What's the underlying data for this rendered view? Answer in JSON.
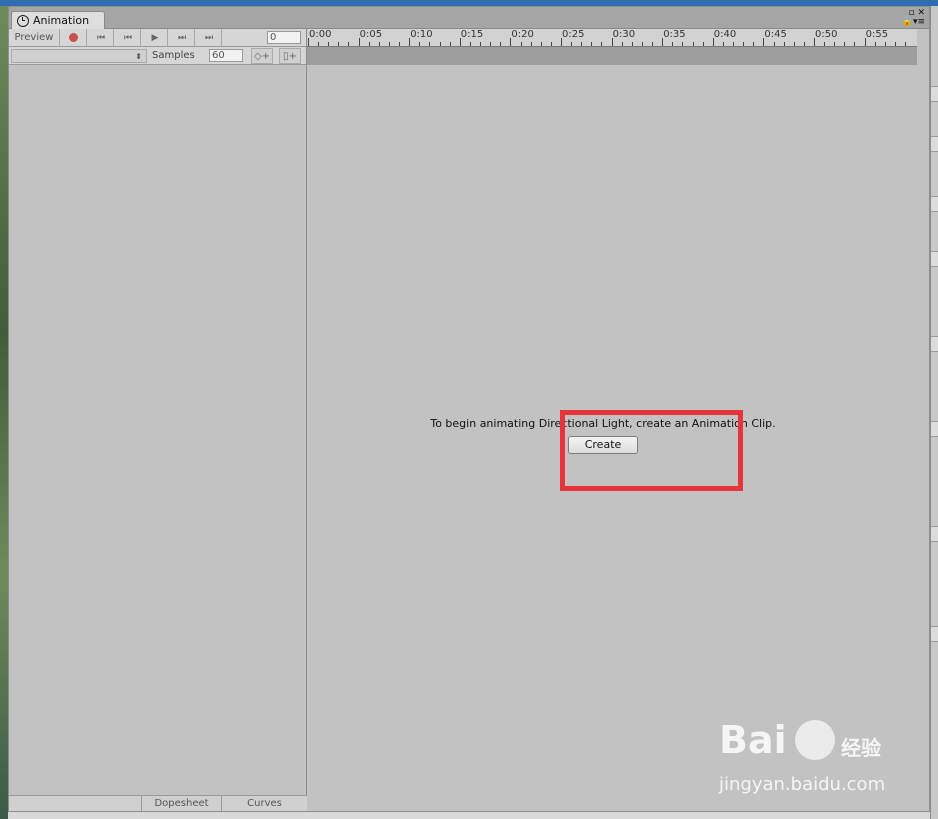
{
  "window": {
    "tab_title": "Animation",
    "corner_icons": "▫ ✕\n🔒▾≡"
  },
  "toolbar": {
    "preview_label": "Preview",
    "first_key_glyph": "⏮",
    "prev_key_glyph": "⏮",
    "play_glyph": "▶",
    "next_key_glyph": "⏭",
    "last_key_glyph": "⏭",
    "frame_value": "0",
    "clip_dropdown_arrow": "⬍",
    "samples_label": "Samples",
    "samples_value": "60",
    "add_keyframe_glyph": "◇+",
    "add_event_glyph": "▯+"
  },
  "ruler": {
    "labels": [
      "0:00",
      "0:05",
      "0:10",
      "0:15",
      "0:20",
      "0:25",
      "0:30",
      "0:35",
      "0:40",
      "0:45",
      "0:50",
      "0:55"
    ]
  },
  "main": {
    "message": "To begin animating Directional Light, create an Animation Clip.",
    "create_label": "Create"
  },
  "bottom_tabs": {
    "dopesheet": "Dopesheet",
    "curves": "Curves"
  },
  "watermark": {
    "brand": "Bai",
    "brand_cn": "经验",
    "url": "jingyan.baidu.com"
  },
  "colors": {
    "highlight": "#e5343a",
    "record": "#c85050",
    "panel_bg": "#c2c2c2"
  }
}
